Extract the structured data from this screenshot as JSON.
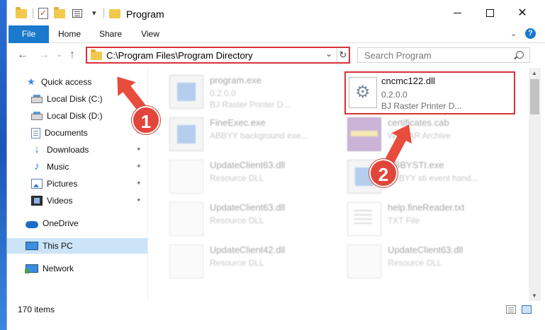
{
  "window": {
    "title": "Program",
    "controls": {
      "minimize": "—",
      "maximize": "",
      "close": "✕"
    }
  },
  "ribbon": {
    "tabs": [
      "File",
      "Home",
      "Share",
      "View"
    ],
    "expand_glyph": "⌄",
    "help_glyph": "?"
  },
  "nav": {
    "back": "←",
    "forward": "→",
    "recent": "⌄",
    "up": "↑",
    "address": "C:\\Program Files\\Program Directory",
    "address_dropdown": "⌄",
    "refresh": "↻",
    "search_placeholder": "Search Program"
  },
  "sidebar": {
    "items": [
      {
        "label": "Quick access",
        "icon": "star-icon"
      },
      {
        "label": "Local Disk (C:)",
        "icon": "drive-icon"
      },
      {
        "label": "Local Disk (D:)",
        "icon": "drive-icon"
      },
      {
        "label": "Documents",
        "icon": "documents-icon",
        "pinned": true
      },
      {
        "label": "Downloads",
        "icon": "downloads-icon",
        "pinned": true
      },
      {
        "label": "Music",
        "icon": "music-icon",
        "pinned": true
      },
      {
        "label": "Pictures",
        "icon": "pictures-icon",
        "pinned": true
      },
      {
        "label": "Videos",
        "icon": "videos-icon",
        "pinned": true
      },
      {
        "label": "OneDrive",
        "icon": "onedrive-icon"
      },
      {
        "label": "This PC",
        "icon": "this-pc-icon",
        "selected": true
      },
      {
        "label": "Network",
        "icon": "network-icon"
      }
    ],
    "pin_glyph": "📌"
  },
  "files": [
    {
      "name": "program.exe",
      "line1": "0.2.0.0",
      "line2": "BJ Raster Printer D...",
      "icon": "exe-icon"
    },
    {
      "name": "cncmc122.dll",
      "line1": "0.2.0.0",
      "line2": "BJ Raster Printer D...",
      "icon": "dll-icon"
    },
    {
      "name": "FineExec.exe",
      "line1": "ABBYY background exe...",
      "line2": "",
      "icon": "exe-icon"
    },
    {
      "name": "certificates.cab",
      "line1": "WinRAR Archive",
      "line2": "",
      "icon": "cab-icon"
    },
    {
      "name": "UpdateClient63.dll",
      "line1": "Resource DLL",
      "line2": "",
      "icon": "dll-icon"
    },
    {
      "name": "ABBYSTI.exe",
      "line1": "ABBYY sti event hand...",
      "line2": "",
      "icon": "exe-icon"
    },
    {
      "name": "UpdateClient63.dll",
      "line1": "Resource DLL",
      "line2": "",
      "icon": "dll-icon"
    },
    {
      "name": "help.fineReader.txt",
      "line1": "TXT File",
      "line2": "",
      "icon": "txt-icon"
    },
    {
      "name": "UpdateClient42.dll",
      "line1": "Resource DLL",
      "line2": "",
      "icon": "dll-icon"
    },
    {
      "name": "UpdateClient63.dll",
      "line1": "Resource DLL",
      "line2": "",
      "icon": "dll-icon"
    }
  ],
  "status": {
    "item_count": "170 items"
  },
  "annotations": {
    "step1": "1",
    "step2": "2"
  },
  "colors": {
    "accent": "#1979ca",
    "highlight": "#d9313a",
    "annotation": "#e74c3c"
  }
}
